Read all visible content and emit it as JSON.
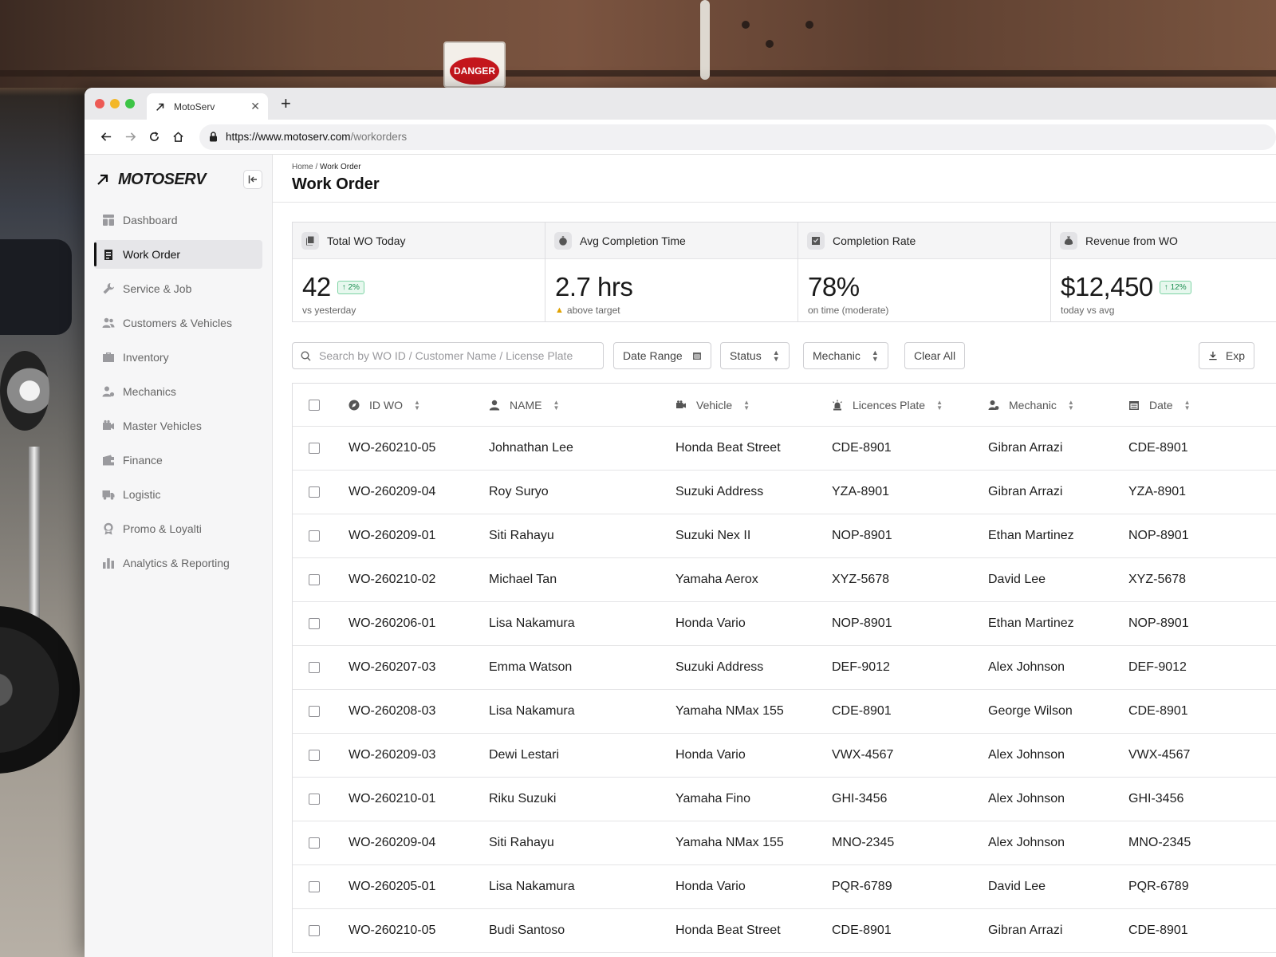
{
  "browser": {
    "tab_title": "MotoServ",
    "url_host": "https://www.motoserv.com",
    "url_path": "/workorders"
  },
  "background": {
    "danger_sign_text": "DANGER"
  },
  "sidebar": {
    "brand": "MOTOSERV",
    "items": [
      {
        "label": "Dashboard",
        "icon": "dashboard-icon",
        "active": false
      },
      {
        "label": "Work Order",
        "icon": "clipboard-icon",
        "active": true
      },
      {
        "label": "Service & Job",
        "icon": "wrench-icon",
        "active": false
      },
      {
        "label": "Customers & Vehicles",
        "icon": "users-icon",
        "active": false
      },
      {
        "label": "Inventory",
        "icon": "box-icon",
        "active": false
      },
      {
        "label": "Mechanics",
        "icon": "user-gear-icon",
        "active": false
      },
      {
        "label": "Master Vehicles",
        "icon": "camera-icon",
        "active": false
      },
      {
        "label": "Finance",
        "icon": "wallet-icon",
        "active": false
      },
      {
        "label": "Logistic",
        "icon": "truck-icon",
        "active": false
      },
      {
        "label": "Promo & Loyalti",
        "icon": "badge-icon",
        "active": false
      },
      {
        "label": "Analytics & Reporting",
        "icon": "bar-chart-icon",
        "active": false
      }
    ]
  },
  "header": {
    "breadcrumb_home": "Home",
    "breadcrumb_sep": " / ",
    "breadcrumb_current": "Work Order",
    "title": "Work Order"
  },
  "stats": [
    {
      "label": "Total WO Today",
      "value": "42",
      "delta": "2%",
      "sub": "vs yesterday",
      "warn": false
    },
    {
      "label": "Avg Completion Time",
      "value": "2.7 hrs",
      "delta": "",
      "sub": "above target",
      "warn": true
    },
    {
      "label": "Completion Rate",
      "value": "78%",
      "delta": "",
      "sub": "on time (moderate)",
      "warn": false
    },
    {
      "label": "Revenue from WO",
      "value": "$12,450",
      "delta": "12%",
      "sub": "today vs avg",
      "warn": false
    }
  ],
  "filters": {
    "search_placeholder": "Search by WO ID / Customer Name / License Plate",
    "date_range": "Date Range",
    "status": "Status",
    "mechanic": "Mechanic",
    "clear_all": "Clear All",
    "export": "Exp"
  },
  "table": {
    "columns": [
      "ID WO",
      "NAME",
      "Vehicle",
      "Licences Plate",
      "Mechanic",
      "Date"
    ],
    "rows": [
      [
        "WO-260210-05",
        "Johnathan Lee",
        "Honda Beat Street",
        "CDE-8901",
        "Gibran Arrazi",
        "CDE-8901"
      ],
      [
        "WO-260209-04",
        "Roy Suryo",
        "Suzuki Address",
        "YZA-8901",
        "Gibran Arrazi",
        "YZA-8901"
      ],
      [
        "WO-260209-01",
        "Siti Rahayu",
        "Suzuki Nex II",
        "NOP-8901",
        "Ethan Martinez",
        "NOP-8901"
      ],
      [
        "WO-260210-02",
        "Michael Tan",
        "Yamaha Aerox",
        "XYZ-5678",
        "David Lee",
        "XYZ-5678"
      ],
      [
        "WO-260206-01",
        "Lisa Nakamura",
        "Honda Vario",
        "NOP-8901",
        "Ethan Martinez",
        "NOP-8901"
      ],
      [
        "WO-260207-03",
        "Emma Watson",
        "Suzuki Address",
        "DEF-9012",
        "Alex Johnson",
        "DEF-9012"
      ],
      [
        "WO-260208-03",
        "Lisa Nakamura",
        "Yamaha NMax 155",
        "CDE-8901",
        "George Wilson",
        "CDE-8901"
      ],
      [
        "WO-260209-03",
        "Dewi Lestari",
        "Honda Vario",
        "VWX-4567",
        "Alex Johnson",
        "VWX-4567"
      ],
      [
        "WO-260210-01",
        "Riku Suzuki",
        "Yamaha Fino",
        "GHI-3456",
        "Alex Johnson",
        "GHI-3456"
      ],
      [
        "WO-260209-04",
        "Siti Rahayu",
        "Yamaha NMax 155",
        "MNO-2345",
        "Alex Johnson",
        "MNO-2345"
      ],
      [
        "WO-260205-01",
        "Lisa Nakamura",
        "Honda Vario",
        "PQR-6789",
        "David Lee",
        "PQR-6789"
      ],
      [
        "WO-260210-05",
        "Budi Santoso",
        "Honda Beat Street",
        "CDE-8901",
        "Gibran Arrazi",
        "CDE-8901"
      ]
    ]
  },
  "colors": {
    "accent": "#111111",
    "sidebar_bg": "#f6f6f7",
    "positive": "#1c8f52",
    "warning": "#e0a100"
  }
}
